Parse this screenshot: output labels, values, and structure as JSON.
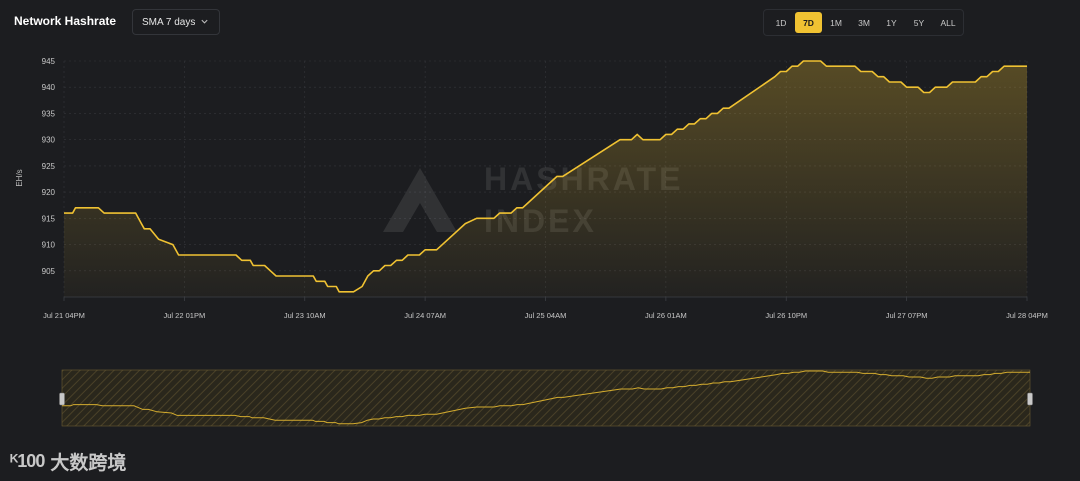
{
  "header": {
    "title": "Network Hashrate",
    "sma_label": "SMA 7 days",
    "ranges": [
      "1D",
      "7D",
      "1M",
      "3M",
      "1Y",
      "5Y",
      "ALL"
    ],
    "active_range": "7D"
  },
  "watermark": {
    "line1": "HASHRATE",
    "line2": "INDEX"
  },
  "brand": {
    "logo": "ᴷ100",
    "text": "大数跨境"
  },
  "colors": {
    "accent": "#f0c232",
    "background": "#1c1d20",
    "grid": "#34363b"
  },
  "chart_data": {
    "type": "area",
    "title": "Network Hashrate",
    "ylabel": "EH/s",
    "xlabel": "",
    "ylim": [
      900,
      945
    ],
    "yticks": [
      905,
      910,
      915,
      920,
      925,
      930,
      935,
      940,
      945
    ],
    "xlim": [
      0,
      168
    ],
    "xticks": [
      {
        "x": 0,
        "label": "Jul 21 04PM"
      },
      {
        "x": 21,
        "label": "Jul 22 01PM"
      },
      {
        "x": 42,
        "label": "Jul 23 10AM"
      },
      {
        "x": 63,
        "label": "Jul 24 07AM"
      },
      {
        "x": 84,
        "label": "Jul 25 04AM"
      },
      {
        "x": 105,
        "label": "Jul 26 01AM"
      },
      {
        "x": 126,
        "label": "Jul 26 10PM"
      },
      {
        "x": 147,
        "label": "Jul 27 07PM"
      },
      {
        "x": 168,
        "label": "Jul 28 04PM"
      }
    ],
    "grid": true,
    "series": [
      {
        "values": [
          [
            0,
            916
          ],
          [
            1.5,
            916
          ],
          [
            2,
            917
          ],
          [
            6,
            917
          ],
          [
            7,
            916
          ],
          [
            12.5,
            916
          ],
          [
            13.5,
            914
          ],
          [
            14,
            913
          ],
          [
            15,
            913
          ],
          [
            16.5,
            911
          ],
          [
            19,
            910
          ],
          [
            20,
            908
          ],
          [
            30,
            908
          ],
          [
            31,
            907
          ],
          [
            32.5,
            907
          ],
          [
            33,
            906
          ],
          [
            35,
            906
          ],
          [
            36,
            905
          ],
          [
            37,
            904
          ],
          [
            43.5,
            904
          ],
          [
            44,
            903
          ],
          [
            45.5,
            903
          ],
          [
            46,
            902
          ],
          [
            47.5,
            902
          ],
          [
            48,
            901
          ],
          [
            50.5,
            901
          ],
          [
            52,
            902
          ],
          [
            53,
            904
          ],
          [
            54,
            905
          ],
          [
            55,
            905
          ],
          [
            56,
            906
          ],
          [
            57,
            906
          ],
          [
            58,
            907
          ],
          [
            59,
            907
          ],
          [
            60,
            908
          ],
          [
            62,
            908
          ],
          [
            63,
            909
          ],
          [
            65,
            909
          ],
          [
            70,
            914
          ],
          [
            72,
            915
          ],
          [
            75,
            915
          ],
          [
            76,
            916
          ],
          [
            78,
            916
          ],
          [
            79,
            917
          ],
          [
            80,
            917
          ],
          [
            81,
            918
          ],
          [
            85,
            922
          ],
          [
            86,
            923
          ],
          [
            87,
            923
          ],
          [
            97,
            930
          ],
          [
            99,
            930
          ],
          [
            100,
            931
          ],
          [
            101,
            930
          ],
          [
            104,
            930
          ],
          [
            105,
            931
          ],
          [
            106,
            931
          ],
          [
            107,
            932
          ],
          [
            108,
            932
          ],
          [
            109,
            933
          ],
          [
            110,
            933
          ],
          [
            111,
            934
          ],
          [
            112,
            934
          ],
          [
            113,
            935
          ],
          [
            114,
            935
          ],
          [
            115,
            936
          ],
          [
            116,
            936
          ],
          [
            124,
            942
          ],
          [
            125,
            943
          ],
          [
            126,
            943
          ],
          [
            127,
            944
          ],
          [
            128,
            944
          ],
          [
            129,
            945
          ],
          [
            132,
            945
          ],
          [
            133,
            944
          ],
          [
            138,
            944
          ],
          [
            139,
            943
          ],
          [
            141,
            943
          ],
          [
            142,
            942
          ],
          [
            143,
            942
          ],
          [
            144,
            941
          ],
          [
            146,
            941
          ],
          [
            147,
            940
          ],
          [
            149,
            940
          ],
          [
            150,
            939
          ],
          [
            151,
            939
          ],
          [
            152,
            940
          ],
          [
            154,
            940
          ],
          [
            155,
            941
          ],
          [
            159,
            941
          ],
          [
            160,
            942
          ],
          [
            161,
            942
          ],
          [
            162,
            943
          ],
          [
            163,
            943
          ],
          [
            164,
            944
          ],
          [
            168,
            944
          ]
        ]
      }
    ]
  }
}
